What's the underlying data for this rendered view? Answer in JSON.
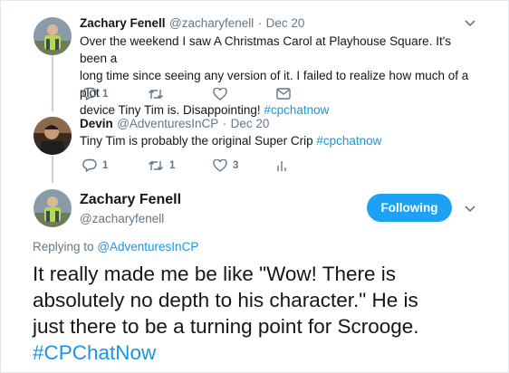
{
  "reply1": {
    "name": "Zachary Fenell",
    "handle": "@zacharyfenell",
    "sep": "·",
    "date": "Dec 20",
    "lines": [
      "Over the weekend I saw A Christmas Carol at Playhouse Square. It's been a",
      "long time since seeing any version of it. I failed to realize how much of a plot",
      "device Tiny Tim is. Disappointing!"
    ],
    "hashtag": "#cpchatnow",
    "reply_count": "1",
    "retweet_count": "",
    "like_count": ""
  },
  "reply2": {
    "name": "Devin",
    "handle": "@AdventuresInCP",
    "sep": "·",
    "date": "Dec 20",
    "text": "Tiny Tim is probably the original Super Crip",
    "hashtag": "#cpchatnow",
    "reply_count": "1",
    "retweet_count": "1",
    "like_count": "3"
  },
  "main": {
    "name": "Zachary Fenell",
    "handle": "@zacharyfenell",
    "follow_label": "Following",
    "replying_prefix": "Replying to",
    "replying_to": "@AdventuresInCP",
    "lines": [
      "It really made me be like \"Wow! There is",
      "absolutely no depth to his character.\" He is",
      "just there to be a turning point for Scrooge."
    ],
    "hashtag": "#CPChatNow"
  },
  "colors": {
    "link": "#1b95e0",
    "button": "#1da1f2",
    "muted": "#657786",
    "thread_line": "#c4d2dc"
  },
  "icons": [
    "reply-icon",
    "retweet-icon",
    "like-icon",
    "direct-message-icon",
    "analytics-icon",
    "chevron-down-icon"
  ]
}
